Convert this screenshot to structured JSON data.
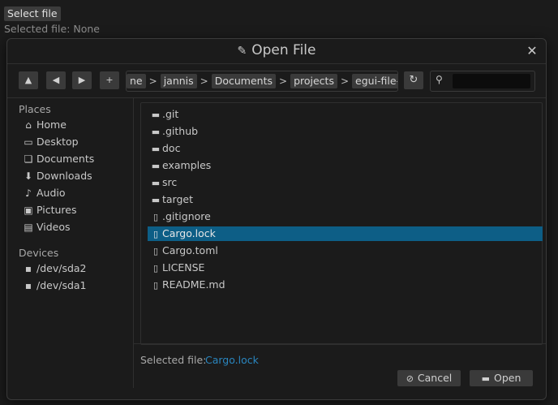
{
  "app": {
    "select_button": "Select file",
    "status_label": "Selected file: None"
  },
  "dialog": {
    "title": "Open File",
    "title_icon": "pencil-icon",
    "nav": {
      "up_glyph": "▲",
      "back_glyph": "◀",
      "forward_glyph": "▶",
      "new_folder_glyph": "+"
    },
    "path": {
      "crumbs": [
        "ne",
        "jannis",
        "Documents",
        "projects",
        "egui-file-dialog"
      ],
      "separator": ">"
    },
    "refresh_glyph": "↻",
    "search": {
      "value": "",
      "placeholder": ""
    },
    "sidebar": {
      "places_label": "Places",
      "places": [
        {
          "label": "Home",
          "icon": "home-icon",
          "glyph": "⌂"
        },
        {
          "label": "Desktop",
          "icon": "monitor-icon",
          "glyph": "▭"
        },
        {
          "label": "Documents",
          "icon": "documents-icon",
          "glyph": "❏"
        },
        {
          "label": "Downloads",
          "icon": "downloads-icon",
          "glyph": "⬇"
        },
        {
          "label": "Audio",
          "icon": "music-icon",
          "glyph": "♪"
        },
        {
          "label": "Pictures",
          "icon": "image-icon",
          "glyph": "▣"
        },
        {
          "label": "Videos",
          "icon": "film-icon",
          "glyph": "▤"
        }
      ],
      "devices_label": "Devices",
      "devices": [
        {
          "label": "/dev/sda2",
          "icon": "drive-icon",
          "glyph": "▪"
        },
        {
          "label": "/dev/sda1",
          "icon": "drive-icon",
          "glyph": "▪"
        }
      ]
    },
    "files": [
      {
        "name": ".git",
        "type": "folder"
      },
      {
        "name": ".github",
        "type": "folder"
      },
      {
        "name": "doc",
        "type": "folder"
      },
      {
        "name": "examples",
        "type": "folder"
      },
      {
        "name": "src",
        "type": "folder"
      },
      {
        "name": "target",
        "type": "folder"
      },
      {
        "name": ".gitignore",
        "type": "file"
      },
      {
        "name": "Cargo.lock",
        "type": "file",
        "selected": true
      },
      {
        "name": "Cargo.toml",
        "type": "file"
      },
      {
        "name": "LICENSE",
        "type": "file"
      },
      {
        "name": "README.md",
        "type": "file"
      }
    ],
    "footer": {
      "selected_label": "Selected file:",
      "selected_value": "Cargo.lock",
      "cancel_label": "Cancel",
      "open_label": "Open"
    },
    "colors": {
      "selection": "#0d5e86",
      "selected_value_text": "#2a86bf"
    }
  }
}
